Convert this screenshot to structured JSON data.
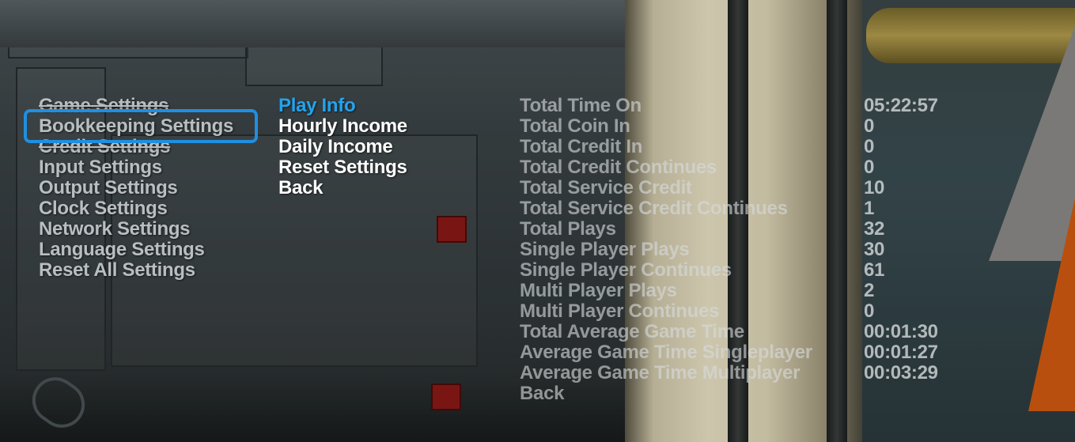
{
  "left_menu": {
    "items": [
      {
        "label": "Game Settings"
      },
      {
        "label": "Bookkeeping Settings"
      },
      {
        "label": "Credit Settings"
      },
      {
        "label": "Input Settings"
      },
      {
        "label": "Output Settings"
      },
      {
        "label": "Clock Settings"
      },
      {
        "label": "Network Settings"
      },
      {
        "label": "Language Settings"
      },
      {
        "label": "Reset All Settings"
      }
    ],
    "selected": "Bookkeeping Settings"
  },
  "sub_menu": {
    "items": [
      {
        "label": "Play Info"
      },
      {
        "label": "Hourly Income"
      },
      {
        "label": "Daily Income"
      },
      {
        "label": "Reset Settings"
      },
      {
        "label": "Back"
      }
    ],
    "active": "Play Info"
  },
  "play_info": {
    "rows": [
      {
        "label": "Total Time On",
        "value": "05:22:57"
      },
      {
        "label": "Total Coin In",
        "value": "0"
      },
      {
        "label": "Total Credit In",
        "value": "0"
      },
      {
        "label": "Total Credit Continues",
        "value": "0"
      },
      {
        "label": "Total Service Credit",
        "value": "10"
      },
      {
        "label": "Total Service Credit Continues",
        "value": "1"
      },
      {
        "label": "Total Plays",
        "value": "32"
      },
      {
        "label": "Single Player Plays",
        "value": "30"
      },
      {
        "label": "Single Player Continues",
        "value": "61"
      },
      {
        "label": "Multi Player Plays",
        "value": "2"
      },
      {
        "label": "Multi Player Continues",
        "value": "0"
      },
      {
        "label": "Total Average Game Time",
        "value": "00:01:30"
      },
      {
        "label": "Average Game Time Singleplayer",
        "value": "00:01:27"
      },
      {
        "label": "Average Game Time Multiplayer",
        "value": "00:03:29"
      }
    ],
    "back_label": "Back"
  },
  "colors": {
    "selection_border": "#1f8fe0",
    "active_item": "#22a4ee",
    "submenu_text": "#ffffff",
    "menu_text": "#b9bec0"
  }
}
